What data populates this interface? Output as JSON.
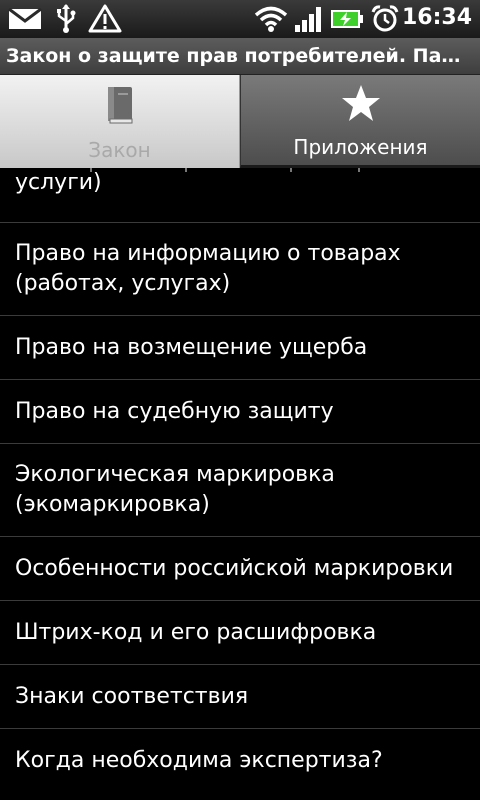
{
  "status_bar": {
    "icons": [
      "mail-icon",
      "usb-icon",
      "warning-icon",
      "wifi-icon",
      "signal-icon",
      "battery-charging-icon",
      "alarm-icon"
    ],
    "time": "16:34"
  },
  "title_bar": {
    "title": "Закон о защите прав потребителей. Памятка"
  },
  "tabs": [
    {
      "label": "Закон",
      "icon": "book-icon",
      "selected": true
    },
    {
      "label": "Приложения",
      "icon": "star-icon",
      "selected": false
    }
  ],
  "list": {
    "items": [
      {
        "label": "услуги)"
      },
      {
        "label": "Право на информацию о товарах (работах, услугах)"
      },
      {
        "label": "Право на возмещение ущерба"
      },
      {
        "label": "Право на судебную защиту"
      },
      {
        "label": "Экологическая маркировка (экомаркировка)"
      },
      {
        "label": "Особенности российской маркировки"
      },
      {
        "label": "Штрих-код и его расшифровка"
      },
      {
        "label": "Знаки соответствия"
      },
      {
        "label": "Когда необходима экспертиза?"
      }
    ]
  },
  "colors": {
    "background": "#000000",
    "selected_tab": "#d9d9d9",
    "unselected_tab": "#5e5e5e",
    "divider": "#3b3b3b",
    "battery_green": "#3fcf2a"
  }
}
